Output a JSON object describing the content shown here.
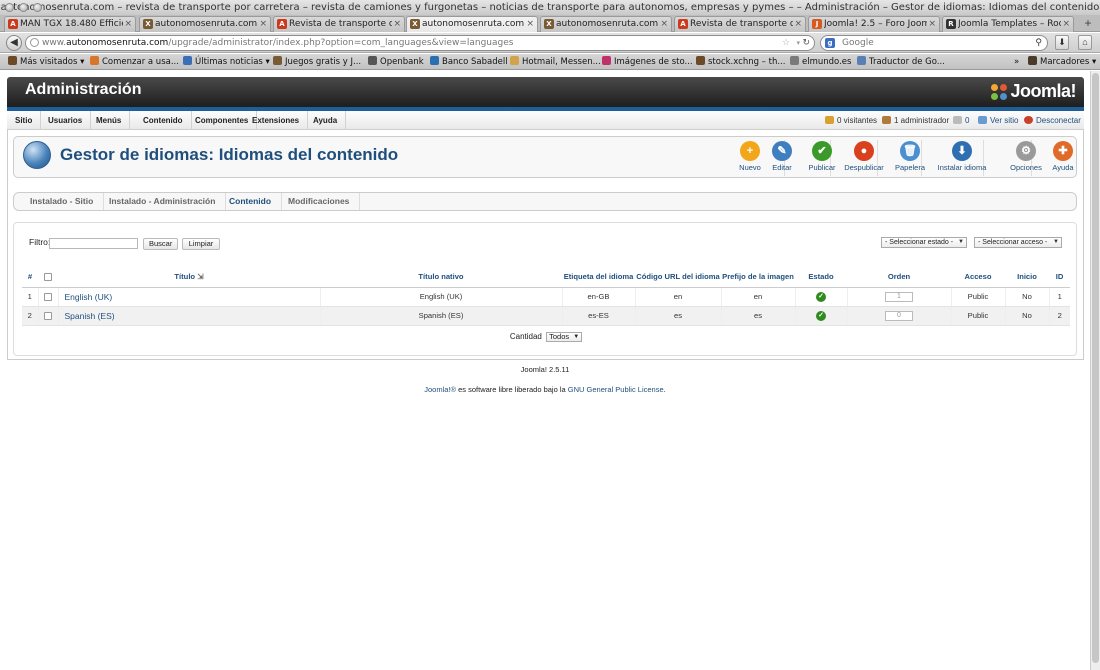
{
  "window": {
    "title": "autonomosenruta.com – revista de transporte por carretera – revista de camiones y furgonetas – noticias de transporte para autonomos, empresas y pymes – – Administración – Gestor de idiomas: Idiomas del contenido"
  },
  "tabs": [
    {
      "label": "MAN TGX 18.480 Efficie...",
      "color": "#cc3a1d",
      "glyph": "A"
    },
    {
      "label": "autonomosenruta.com –...",
      "color": "#7a5a33",
      "glyph": "X"
    },
    {
      "label": "Revista de transporte d...",
      "color": "#cc3a1d",
      "glyph": "A"
    },
    {
      "label": "autonomosenruta.com –...",
      "color": "#7a5a33",
      "glyph": "X",
      "active": true
    },
    {
      "label": "autonomosenruta.com –...",
      "color": "#7a5a33",
      "glyph": "X"
    },
    {
      "label": "Revista de transporte d...",
      "color": "#cc3a1d",
      "glyph": "A"
    },
    {
      "label": "Joomla! 2.5 – Foro Joom...",
      "color": "#d45a22",
      "glyph": "J"
    },
    {
      "label": "Joomla Templates – Roc...",
      "color": "#333333",
      "glyph": "R"
    }
  ],
  "navbar": {
    "url_prefix": "www.",
    "url_domain": "autonomosenruta.com",
    "url_path": "/upgrade/administrator/index.php?option=com_languages&view=languages",
    "search_placeholder": "Google"
  },
  "bookmarks": [
    {
      "label": "Más visitados ▾",
      "color": "#6b4a2a"
    },
    {
      "label": "Comenzar a usa...",
      "color": "#d9742b"
    },
    {
      "label": "Últimas noticias ▾",
      "color": "#3a6fb8"
    },
    {
      "label": "Juegos gratis y J...",
      "color": "#7a5a33"
    },
    {
      "label": "Openbank",
      "color": "#555555"
    },
    {
      "label": "Banco Sabadell",
      "color": "#2a6fb0"
    },
    {
      "label": "Hotmail, Messen...",
      "color": "#d4a24a"
    },
    {
      "label": "Imágenes de sto...",
      "color": "#c0316c"
    },
    {
      "label": "stock.xchng – th...",
      "color": "#6b4a2a"
    },
    {
      "label": "elmundo.es",
      "color": "#7a7a7a"
    },
    {
      "label": "Traductor de Go...",
      "color": "#5a7fb5"
    },
    {
      "label": "Marcadores ▾",
      "color": "#4a3a2a"
    }
  ],
  "header": {
    "title": "Administración",
    "logo_text": "Joomla!"
  },
  "menu": [
    "Sitio",
    "Usuarios",
    "Menús",
    "Contenido",
    "Componentes",
    "Extensiones",
    "Ayuda"
  ],
  "status": {
    "visitors": "0 visitantes",
    "admins": "1 administrador",
    "messages": "0",
    "view_site": "Ver sitio",
    "logout": "Desconectar"
  },
  "page": {
    "title": "Gestor de idiomas: Idiomas del contenido"
  },
  "toolbar": [
    {
      "label": "Nuevo",
      "color": "#f2a619",
      "glyph": "+"
    },
    {
      "label": "Editar",
      "color": "#3f7fc0",
      "glyph": "✎"
    },
    {
      "label": "Publicar",
      "color": "#3a9a2a",
      "glyph": "✔"
    },
    {
      "label": "Despublicar",
      "color": "#d8401e",
      "glyph": "●"
    },
    {
      "label": "Papelera",
      "color": "#4a90d0",
      "glyph": "🗑"
    },
    {
      "label": "Instalar idioma",
      "color": "#2e6fb2",
      "glyph": "⬇"
    },
    {
      "label": "Opciones",
      "color": "#9a9a9a",
      "glyph": "⚙"
    },
    {
      "label": "Ayuda",
      "color": "#e06a2a",
      "glyph": "✚"
    }
  ],
  "subtabs": [
    {
      "label": "Instalado - Sitio"
    },
    {
      "label": "Instalado - Administración"
    },
    {
      "label": "Contenido",
      "active": true
    },
    {
      "label": "Modificaciones"
    }
  ],
  "filter": {
    "label": "Filtro:",
    "value": "",
    "search_button": "Buscar",
    "clear_button": "Limpiar",
    "state_select": "- Seleccionar estado -",
    "access_select": "- Seleccionar acceso -"
  },
  "table": {
    "headers": {
      "num": "#",
      "title": "Título",
      "native": "Título nativo",
      "tag": "Etiqueta del idioma",
      "url": "Código URL del idioma",
      "image": "Prefijo de la imagen",
      "state": "Estado",
      "order": "Orden",
      "access": "Acceso",
      "home": "Inicio",
      "id": "ID"
    },
    "rows": [
      {
        "num": "1",
        "title": "English (UK)",
        "native": "English (UK)",
        "tag": "en-GB",
        "url": "en",
        "image": "en",
        "published": true,
        "order": "1",
        "access": "Public",
        "home": "No",
        "id": "1"
      },
      {
        "num": "2",
        "title": "Spanish (ES)",
        "native": "Spanish (ES)",
        "tag": "es-ES",
        "url": "es",
        "image": "es",
        "published": true,
        "order": "0",
        "access": "Public",
        "home": "No",
        "id": "2"
      }
    ]
  },
  "pagination": {
    "label": "Cantidad",
    "value": "Todos"
  },
  "footer": {
    "version": "Joomla! 2.5.11",
    "link1": "Joomla!®",
    "text": " es software libre liberado bajo la ",
    "link2": "GNU General Public License",
    "end": "."
  }
}
